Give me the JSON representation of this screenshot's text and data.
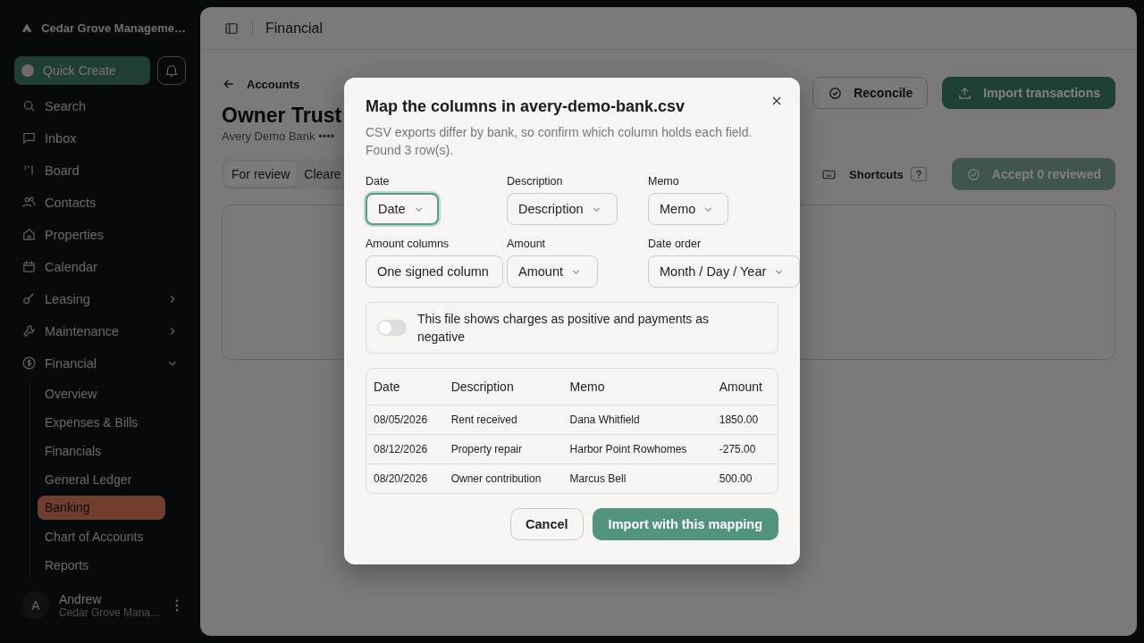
{
  "sidebar": {
    "org": "Cedar Grove Manageme…",
    "quick_create": "Quick Create",
    "items": [
      {
        "label": "Search"
      },
      {
        "label": "Inbox"
      },
      {
        "label": "Board"
      },
      {
        "label": "Contacts"
      },
      {
        "label": "Properties"
      },
      {
        "label": "Calendar"
      },
      {
        "label": "Leasing",
        "expanded": false
      },
      {
        "label": "Maintenance",
        "expanded": false
      },
      {
        "label": "Financial",
        "expanded": true,
        "children": [
          {
            "label": "Overview",
            "selected": false
          },
          {
            "label": "Expenses & Bills",
            "selected": false
          },
          {
            "label": "Financials",
            "selected": false
          },
          {
            "label": "General Ledger",
            "selected": false
          },
          {
            "label": "Banking",
            "selected": true
          },
          {
            "label": "Chart of Accounts",
            "selected": false
          },
          {
            "label": "Reports",
            "selected": false
          }
        ]
      }
    ],
    "user": {
      "initial": "A",
      "name": "Andrew",
      "org": "Cedar Grove Mana…"
    }
  },
  "header": {
    "title": "Financial"
  },
  "page": {
    "back": "Accounts",
    "title": "Owner Trust",
    "subtitle": "Avery Demo Bank ••••",
    "actions": [
      "Reconcile",
      "Import transactions"
    ],
    "tabs": [
      {
        "label": "For review",
        "selected": true
      },
      {
        "label": "Cleare",
        "selected": false
      }
    ],
    "shortcuts": "Shortcuts",
    "shortcut_key": "?",
    "accept": {
      "label": "Accept 0 reviewed",
      "disabled": true
    }
  },
  "modal": {
    "title": "Map the columns in avery-demo-bank.csv",
    "description": "CSV exports differ by bank, so confirm which column holds each field. Found 3 row(s).",
    "fields": [
      {
        "label": "Date",
        "value": "Date",
        "focused": true
      },
      {
        "label": "Description",
        "value": "Description",
        "focused": false
      },
      {
        "label": "Memo",
        "value": "Memo",
        "focused": false
      },
      {
        "label": "Amount columns",
        "value": "One signed column",
        "focused": false
      },
      {
        "label": "Amount",
        "value": "Amount",
        "focused": false
      },
      {
        "label": "Date order",
        "value": "Month / Day / Year",
        "focused": false
      }
    ],
    "toggle": {
      "label": "This file shows charges as positive and payments as negative",
      "on": false
    },
    "preview": {
      "columns": [
        "Date",
        "Description",
        "Memo",
        "Amount"
      ],
      "rows": [
        [
          "08/05/2026",
          "Rent received",
          "Dana Whitfield",
          "1850.00"
        ],
        [
          "08/12/2026",
          "Property repair",
          "Harbor Point Rowhomes",
          "-275.00"
        ],
        [
          "08/20/2026",
          "Owner contribution",
          "Marcus Bell",
          "500.00"
        ]
      ]
    },
    "cancel": "Cancel",
    "confirm": "Import with this mapping"
  }
}
